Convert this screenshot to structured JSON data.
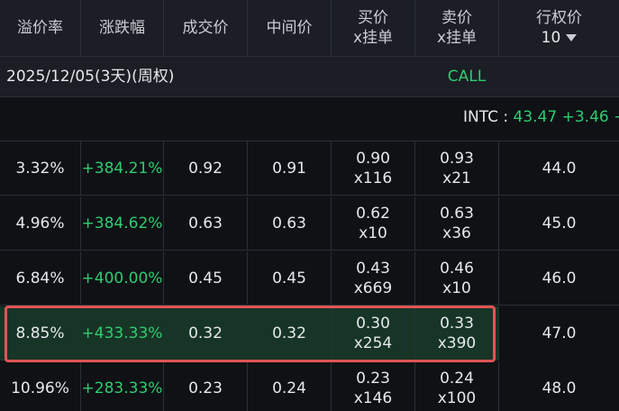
{
  "headers": {
    "premium": "溢价率",
    "change": "涨跌幅",
    "last": "成交价",
    "mid": "中间价",
    "bid_line1": "买价",
    "bid_line2": "x挂单",
    "ask_line1": "卖价",
    "ask_line2": "x挂单",
    "strike_line1": "行权价",
    "strike_select": "10"
  },
  "expiry": {
    "date": "2025/12/05(3天)(周权)",
    "side": "CALL"
  },
  "underlying": {
    "symbol": "INTC : ",
    "price": "43.47",
    "change": "+3.46",
    "more": "+"
  },
  "rows": [
    {
      "premium": "3.32%",
      "change": "+384.21%",
      "last": "0.92",
      "mid": "0.91",
      "bid": "0.90",
      "bid_size": "x116",
      "ask": "0.93",
      "ask_size": "x21",
      "strike": "44.0"
    },
    {
      "premium": "4.96%",
      "change": "+384.62%",
      "last": "0.63",
      "mid": "0.63",
      "bid": "0.62",
      "bid_size": "x10",
      "ask": "0.63",
      "ask_size": "x36",
      "strike": "45.0"
    },
    {
      "premium": "6.84%",
      "change": "+400.00%",
      "last": "0.45",
      "mid": "0.45",
      "bid": "0.43",
      "bid_size": "x669",
      "ask": "0.46",
      "ask_size": "x10",
      "strike": "46.0"
    },
    {
      "premium": "8.85%",
      "change": "+433.33%",
      "last": "0.32",
      "mid": "0.32",
      "bid": "0.30",
      "bid_size": "x254",
      "ask": "0.33",
      "ask_size": "x390",
      "strike": "47.0"
    },
    {
      "premium": "10.96%",
      "change": "+283.33%",
      "last": "0.23",
      "mid": "0.24",
      "bid": "0.23",
      "bid_size": "x146",
      "ask": "0.24",
      "ask_size": "x100",
      "strike": "48.0"
    }
  ],
  "colors": {
    "positive": "#2ecc71",
    "highlight": "#e05555",
    "selected_row": "#173526"
  }
}
